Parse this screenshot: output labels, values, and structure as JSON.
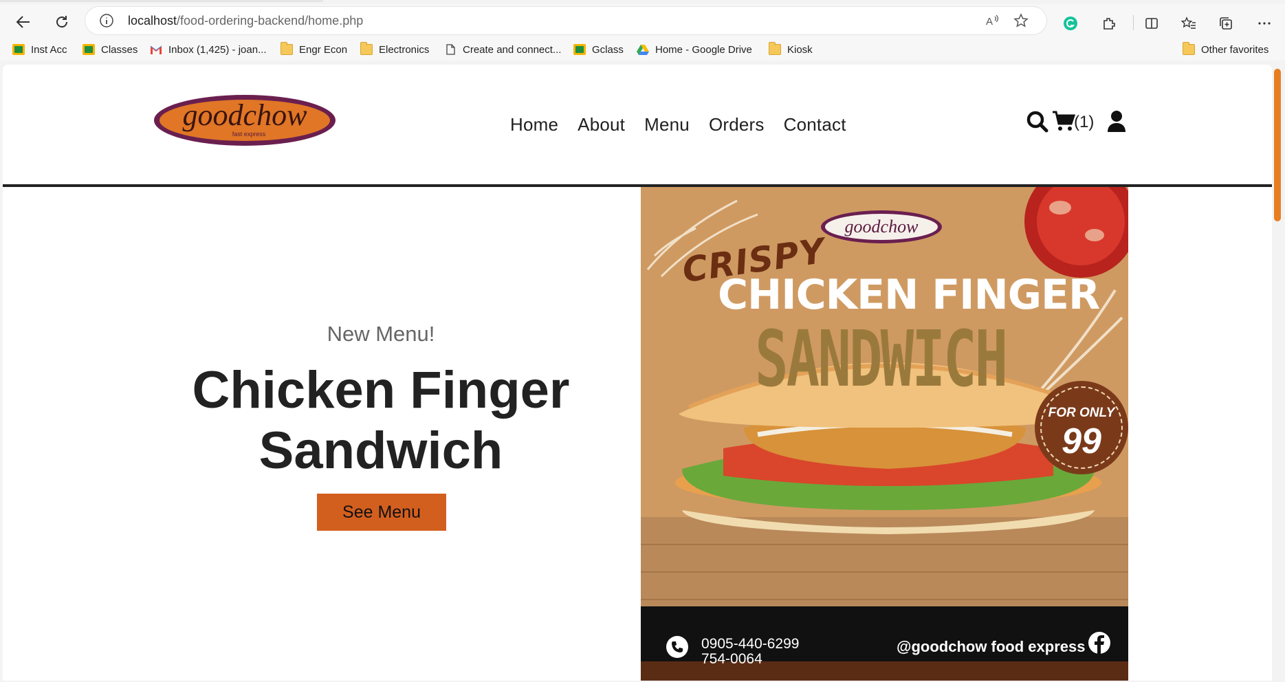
{
  "browser": {
    "url_host": "localhost",
    "url_path": "/food-ordering-backend/home.php",
    "bookmarks": [
      {
        "label": "Inst Acc",
        "icon": "classroom-icon"
      },
      {
        "label": "Classes",
        "icon": "classroom-icon"
      },
      {
        "label": "Inbox (1,425) - joan...",
        "icon": "gmail-icon"
      },
      {
        "label": "Engr Econ",
        "icon": "folder-icon"
      },
      {
        "label": "Electronics",
        "icon": "folder-icon"
      },
      {
        "label": "Create and connect...",
        "icon": "page-icon"
      },
      {
        "label": "Gclass",
        "icon": "classroom-icon"
      },
      {
        "label": "Home - Google Drive",
        "icon": "drive-icon"
      },
      {
        "label": "Kiosk",
        "icon": "folder-icon"
      }
    ],
    "other_favorites": "Other favorites"
  },
  "site": {
    "logo_text": "goodchow",
    "logo_subtext": "fast express",
    "nav": [
      "Home",
      "About",
      "Menu",
      "Orders",
      "Contact"
    ],
    "cart_count": "(1)",
    "accent_color": "#d35f1f"
  },
  "hero": {
    "subtitle": "New Menu!",
    "title_line1": "Chicken Finger",
    "title_line2": "Sandwich",
    "button": "See Menu"
  },
  "poster": {
    "logo_text": "goodchow",
    "crispy": "CRISPY",
    "line1": "CHICKEN FINGER",
    "line2": "SANDWICH",
    "badge_label": "FOR ONLY",
    "badge_price": "99",
    "phone1": "0905-440-6299",
    "phone2": "754-0064",
    "social": "@goodchow food express"
  }
}
